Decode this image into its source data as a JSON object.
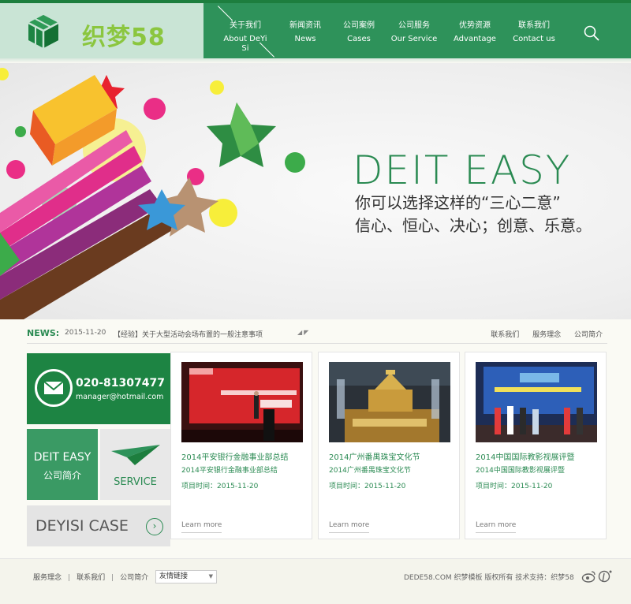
{
  "brand": {
    "logo_text": "织梦58",
    "accent": "#2e925a",
    "dark_green": "#1d8443",
    "light_green": "#8bc63f"
  },
  "nav": {
    "items": [
      {
        "cn": "关于我们",
        "en": "About DeYi Si"
      },
      {
        "cn": "新闻资讯",
        "en": "News"
      },
      {
        "cn": "公司案例",
        "en": "Cases"
      },
      {
        "cn": "公司服务",
        "en": "Our Service"
      },
      {
        "cn": "优势资源",
        "en": "Advantage"
      },
      {
        "cn": "联系我们",
        "en": "Contact us"
      }
    ],
    "search_icon": "search-icon"
  },
  "banner": {
    "title": "DEIT EASY",
    "line1": "你可以选择这样的“三心二意”",
    "line2": "信心、恒心、决心；创意、乐意。"
  },
  "news": {
    "label": "NEWS:",
    "date": "2015-11-20",
    "title": "【经验】关于大型活动会场布置的一般注意事项",
    "links": [
      "联系我们",
      "服务理念",
      "公司简介"
    ]
  },
  "tiles": {
    "phone": "020-81307477",
    "email": "manager@hotmail.com",
    "about_brand": "DEIT EASY",
    "about_label": "公司简介",
    "service_label": "SERVICE",
    "case_label": "DEYISI CASE"
  },
  "cards": [
    {
      "title": "2014平安银行金融事业部总结",
      "sub": "2014平安银行金融事业部总结",
      "date": "项目时间：2015-11-20",
      "more": "Learn more"
    },
    {
      "title": "2014广州番禺珠宝文化节",
      "sub": "2014广州番禺珠宝文化节",
      "date": "项目时间：2015-11-20",
      "more": "Learn more"
    },
    {
      "title": "2014中国国际教影视展评暨",
      "sub": "2014中国国际教影视展评暨",
      "date": "项目时间：2015-11-20",
      "more": "Learn more"
    }
  ],
  "footer": {
    "links": [
      "服务理念",
      "联系我们",
      "公司简介"
    ],
    "friend_select": "友情链接",
    "copyright": "DEDE58.COM 织梦模板 版权所有   技术支持：织梦58"
  }
}
